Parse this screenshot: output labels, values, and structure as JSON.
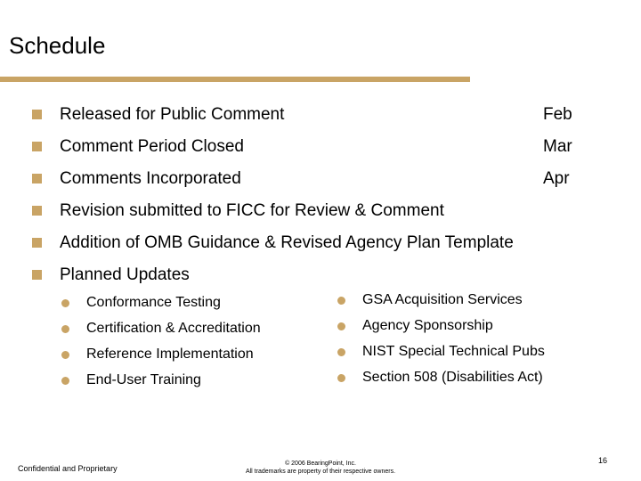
{
  "slide": {
    "title": "Schedule",
    "accent_color": "#C9A465"
  },
  "milestones": [
    {
      "label": "Released for Public Comment",
      "date": "Feb"
    },
    {
      "label": "Comment Period Closed",
      "date": "Mar"
    },
    {
      "label": "Comments Incorporated",
      "date": "Apr"
    },
    {
      "label": "Revision submitted to FICC for Review & Comment",
      "date": ""
    },
    {
      "label": "Addition of OMB Guidance & Revised Agency Plan Template",
      "date": ""
    },
    {
      "label": "Planned Updates",
      "date": ""
    }
  ],
  "planned_updates": {
    "left": [
      "Conformance Testing",
      "Certification & Accreditation",
      "Reference Implementation",
      "End-User Training"
    ],
    "right": [
      "GSA Acquisition Services",
      "Agency Sponsorship",
      "NIST Special Technical Pubs",
      "Section 508 (Disabilities Act)"
    ]
  },
  "footer": {
    "confidential": "Confidential and Proprietary",
    "copyright": "© 2006 BearingPoint, Inc.",
    "trademarks": "All trademarks are property of their respective owners.",
    "page_number": "16"
  }
}
